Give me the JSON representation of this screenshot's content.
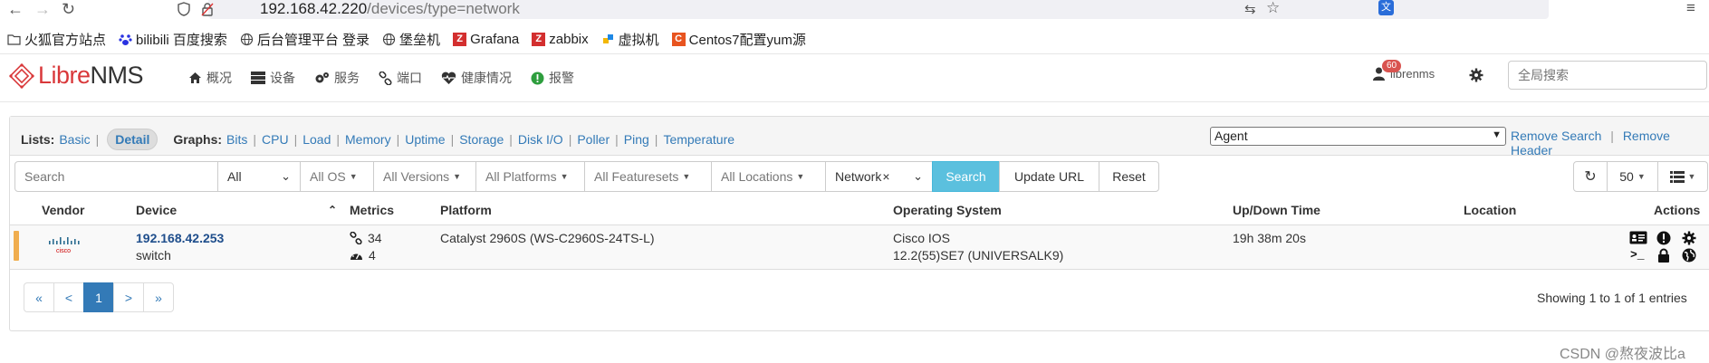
{
  "browser": {
    "url_host": "192.168.42.220",
    "url_path": "/devices/type=network",
    "bookmarks": [
      {
        "label": "火狐官方站点",
        "icon": "folder-icon"
      },
      {
        "label": "bilibili 百度搜索",
        "icon": "paw-icon"
      },
      {
        "label": "后台管理平台 登录",
        "icon": "globe-icon"
      },
      {
        "label": "堡垒机",
        "icon": "globe-icon"
      },
      {
        "label": "Grafana",
        "icon": "z-icon"
      },
      {
        "label": "zabbix",
        "icon": "z-icon"
      },
      {
        "label": "虚拟机",
        "icon": "puzzle-icon"
      },
      {
        "label": "Centos7配置yum源",
        "icon": "c-icon"
      }
    ]
  },
  "app": {
    "logo_prefix": "Libre",
    "logo_suffix": "NMS",
    "menu": [
      "概况",
      "设备",
      "服务",
      "端口",
      "健康情况",
      "报警"
    ],
    "alert_count": "60",
    "username": "librenms",
    "global_search_placeholder": "全局搜索"
  },
  "lists": {
    "label": "Lists:",
    "basic": "Basic",
    "detail": "Detail",
    "graphs_label": "Graphs:",
    "graphs": [
      "Bits",
      "CPU",
      "Load",
      "Memory",
      "Uptime",
      "Storage",
      "Disk I/O",
      "Poller",
      "Ping",
      "Temperature"
    ],
    "agent_value": "Agent",
    "remove_search": "Remove Search",
    "remove_header": "Remove Header"
  },
  "filters": {
    "search_placeholder": "Search",
    "all": "All",
    "os": "All OS",
    "versions": "All Versions",
    "platforms": "All Platforms",
    "featuresets": "All Featuresets",
    "locations": "All Locations",
    "type": "Network",
    "search_btn": "Search",
    "update_url_btn": "Update URL",
    "reset_btn": "Reset",
    "page_size": "50"
  },
  "table": {
    "headers": [
      "Vendor",
      "Device",
      "Metrics",
      "Platform",
      "Operating System",
      "Up/Down Time",
      "Location",
      "Actions"
    ],
    "rows": [
      {
        "vendor": "cisco",
        "device": "192.168.42.253",
        "device_type": "switch",
        "ports": "34",
        "sensors": "4",
        "platform": "Catalyst 2960S (WS-C2960S-24TS-L)",
        "os": "Cisco IOS",
        "os_version": "12.2(55)SE7 (UNIVERSALK9)",
        "uptime": "19h 38m 20s",
        "location": ""
      }
    ]
  },
  "pagination": {
    "first": "«",
    "prev": "<",
    "current": "1",
    "next": ">",
    "last": "»",
    "summary": "Showing 1 to 1 of 1 entries"
  },
  "watermark": "CSDN @熬夜波比a",
  "colors": {
    "accent": "#337ab7",
    "logo_red": "#d9383a",
    "status_warning": "#f0ad4e",
    "search_btn": "#5bc0de",
    "badge": "#d9534f"
  }
}
